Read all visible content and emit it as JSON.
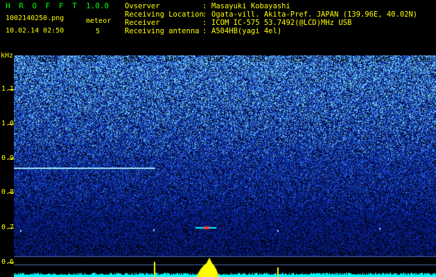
{
  "header": {
    "app_title": "H R O F F T",
    "app_version": "1.0.0",
    "file_name": "1002140250.png",
    "date_time": "10.02.14 02:50",
    "meteor_label": "meteor",
    "meteor_count": "5"
  },
  "info": {
    "colon": ":",
    "observer_label": "Ovserver",
    "observer_value": "Masayuki Kobayashi",
    "location_label": "Receiving Location",
    "location_value": "Ogata-vill. Akita-Pref. JAPAN (139.96E, 40.02N)",
    "receiver_label": "Receiver",
    "receiver_value": "ICOM IC-575 53.7492(@LCD)MHz USB",
    "antenna_label": "Receiving antenna",
    "antenna_value": "A504HB(yagi 4el)"
  },
  "spectrogram": {
    "y_unit": "kHz",
    "y_ticks": [
      "1.1",
      "1.0",
      "0.9",
      "0.8",
      "0.7",
      "0.6"
    ],
    "x_ticks": [
      "0251",
      "0252",
      "0253",
      "0254",
      "0255",
      "0256",
      "0257",
      "0258",
      "0259",
      "0300"
    ],
    "colors": {
      "background": "#000000",
      "text": "#ffff00",
      "title": "#00ff00",
      "noise_dark": "#0a1a7a",
      "noise_light": "#6fd8ff",
      "spectrum": "#00ffff",
      "peak": "#ffff00"
    }
  }
}
